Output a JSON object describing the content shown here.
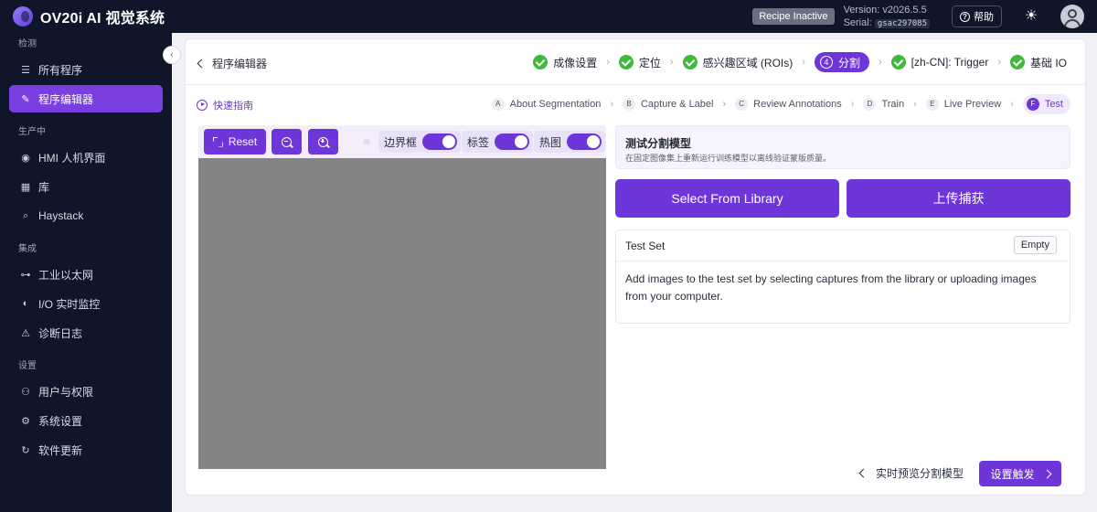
{
  "app": {
    "title": "OV20i AI 视觉系统",
    "recipe_status": "Recipe Inactive",
    "version": "Version: v2026.5.5",
    "serial_label": "Serial:",
    "serial_value": "gsac297085",
    "help_label": "帮助"
  },
  "sidebar": {
    "sections": [
      {
        "title": "检测",
        "items": [
          {
            "label": "所有程序",
            "icon": "list-icon"
          },
          {
            "label": "程序编辑器",
            "icon": "edit-icon",
            "active": true
          }
        ]
      },
      {
        "title": "生产中",
        "items": [
          {
            "label": "HMI 人机界面",
            "icon": "eye-icon"
          },
          {
            "label": "库",
            "icon": "grid-icon"
          },
          {
            "label": "Haystack",
            "icon": "search-icon"
          }
        ]
      },
      {
        "title": "集成",
        "items": [
          {
            "label": "工业以太网",
            "icon": "network-icon"
          },
          {
            "label": "I/O 实时监控",
            "icon": "io-icon"
          },
          {
            "label": "诊断日志",
            "icon": "alarm-icon"
          }
        ]
      },
      {
        "title": "设置",
        "items": [
          {
            "label": "用户与权限",
            "icon": "user-icon"
          },
          {
            "label": "系统设置",
            "icon": "gear-icon"
          },
          {
            "label": "软件更新",
            "icon": "refresh-icon"
          }
        ]
      }
    ]
  },
  "header": {
    "back_label": "程序编辑器",
    "steps": [
      {
        "label": "成像设置",
        "done": true
      },
      {
        "label": "定位",
        "done": true
      },
      {
        "label": "感兴趣区域 (ROIs)",
        "done": true
      },
      {
        "label": "分割",
        "num": "4",
        "active": true
      },
      {
        "label": "[zh-CN]: Trigger",
        "done": true
      },
      {
        "label": "基础 IO",
        "done": true
      }
    ]
  },
  "subnav": {
    "guide_label": "快速指南",
    "steps": [
      {
        "letter": "A",
        "label": "About Segmentation"
      },
      {
        "letter": "B",
        "label": "Capture & Label"
      },
      {
        "letter": "C",
        "label": "Review Annotations"
      },
      {
        "letter": "D",
        "label": "Train"
      },
      {
        "letter": "E",
        "label": "Live Preview"
      },
      {
        "letter": "F",
        "label": "Test",
        "active": true
      }
    ]
  },
  "viewer": {
    "reset_label": "Reset",
    "toggles": [
      {
        "label": "边界框",
        "on": true
      },
      {
        "label": "标签",
        "on": true
      },
      {
        "label": "热图",
        "on": true
      }
    ]
  },
  "panel": {
    "title": "测试分割模型",
    "subtitle": "在固定图像集上重新运行训练模型以离线验证蒙版质量。",
    "library_button": "Select From Library",
    "upload_button": "上传捕获",
    "testset_title": "Test Set",
    "testset_badge": "Empty",
    "testset_body": "Add images to the test set by selecting captures from the library or uploading images from your computer."
  },
  "footer": {
    "prev_label": "实时预览分割模型",
    "next_label": "设置触发"
  },
  "colors": {
    "accent": "#6e36d9",
    "sidebar_bg": "#0f1629",
    "success": "#3fb83b"
  }
}
